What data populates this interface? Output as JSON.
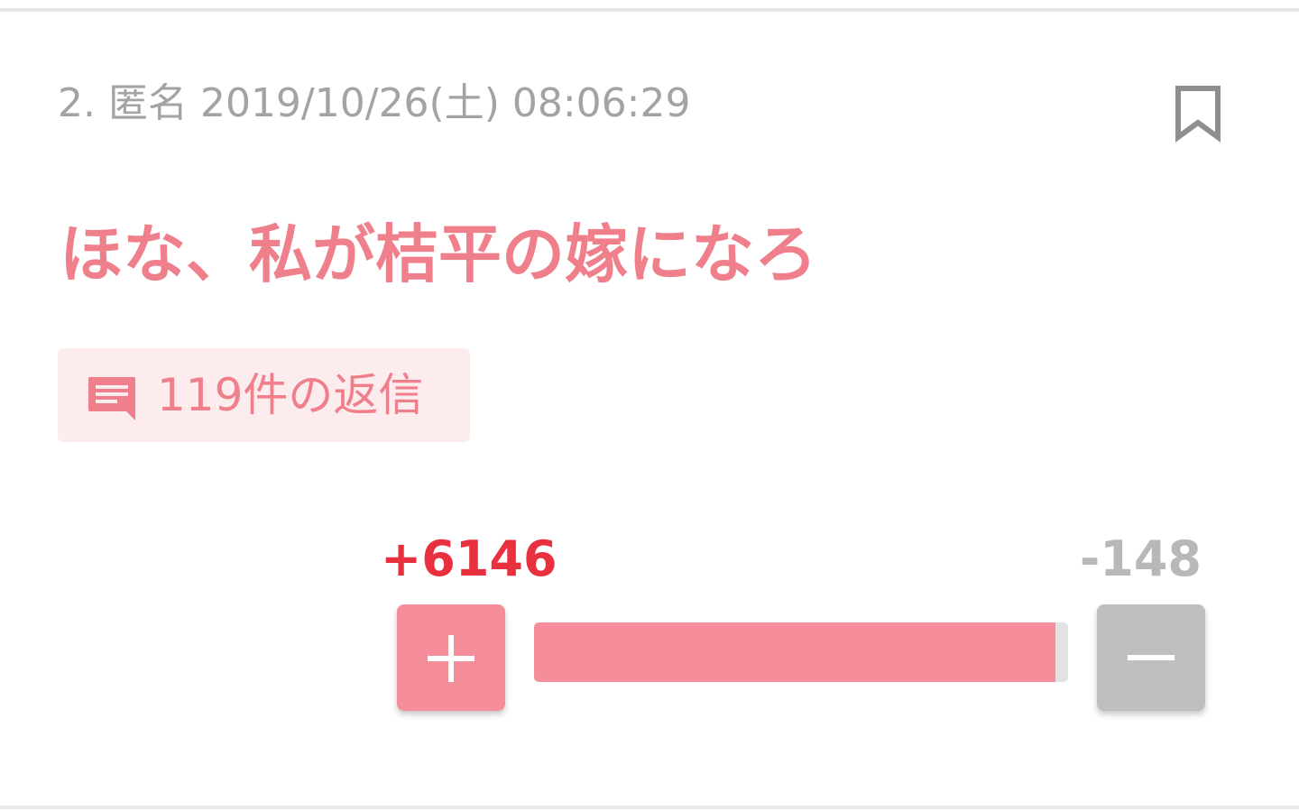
{
  "post": {
    "meta": "2. 匿名 2019/10/26(土) 08:06:29",
    "title": "ほな、私が桔平の嫁になろ",
    "replies_label": "119件の返信"
  },
  "votes": {
    "plus_label": "+6146",
    "minus_label": "-148",
    "plus": 6146,
    "minus": 148,
    "plus_share": 0.9765
  },
  "icons": {
    "bookmark": "bookmark-outline-icon",
    "reply": "chat-bubble-icon",
    "plus": "plus-icon",
    "minus": "minus-icon"
  },
  "colors": {
    "accent": "#f07f8c",
    "plus_button": "#f58d9a",
    "plus_text": "#e8303f",
    "minus_button": "#bfbfbf",
    "minus_text": "#b8b8b8",
    "pill_bg": "#fdecee"
  }
}
